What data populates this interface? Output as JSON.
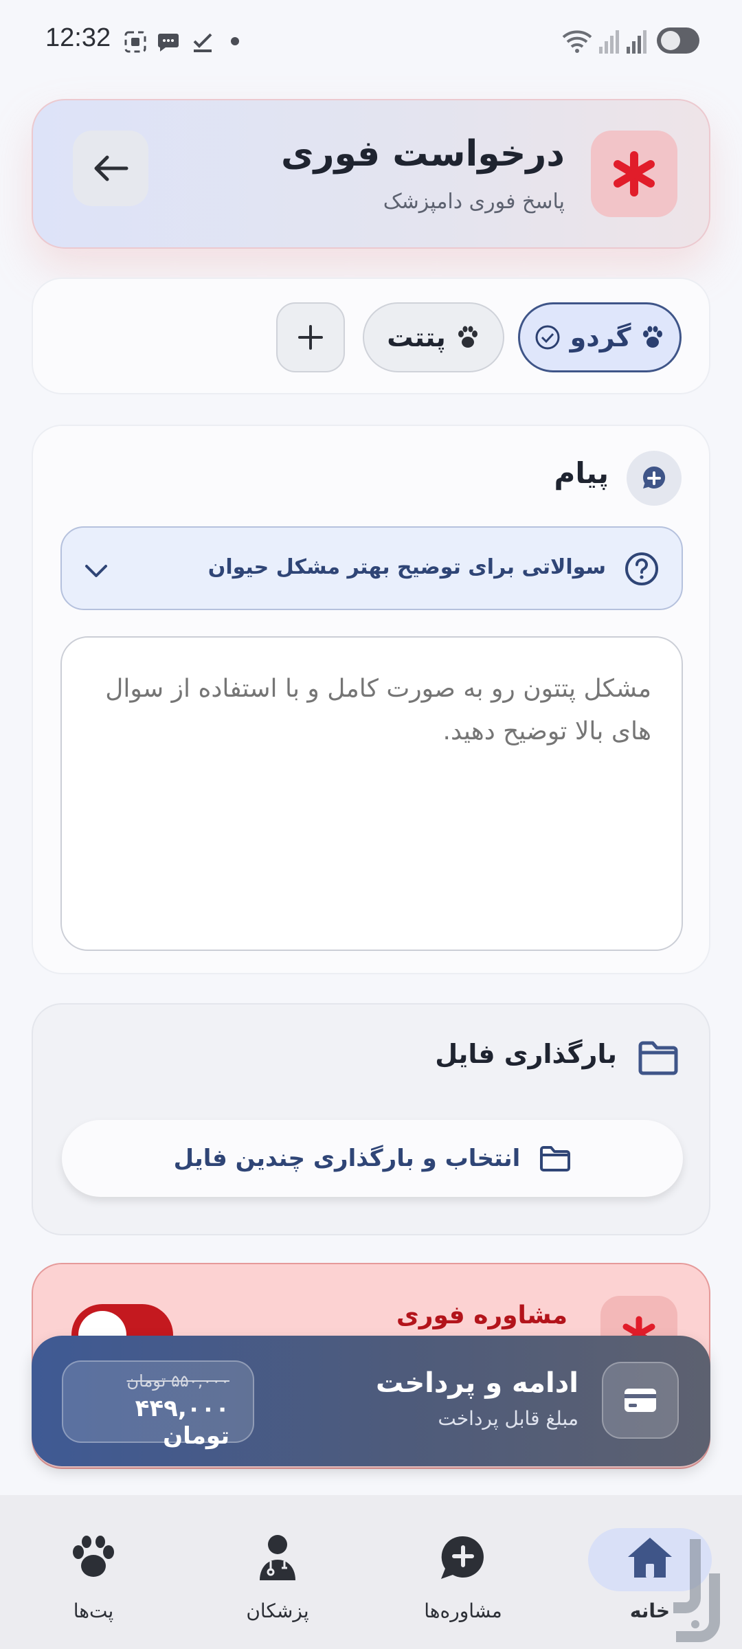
{
  "status_bar": {
    "time": "12:32"
  },
  "header": {
    "title": "درخواست فوری",
    "subtitle": "پاسخ فوری دامپزشک",
    "badge_color": "#e11d2a"
  },
  "pets": {
    "items": [
      {
        "name": "گردو",
        "selected": true
      },
      {
        "name": "پتتت",
        "selected": false
      }
    ],
    "add_icon": "plus-icon"
  },
  "message": {
    "title": "پیام",
    "faq_label": "سوالاتی برای توضیح بهتر مشکل حیوان",
    "placeholder": "مشکل پتتون رو به صورت کامل و با استفاده از سوال های بالا توضیح دهید."
  },
  "upload": {
    "title": "بارگذاری فایل",
    "button_label": "انتخاب و بارگذاری چندین فایل"
  },
  "urgent": {
    "title": "مشاوره فوری",
    "enabled": true
  },
  "payment": {
    "title": "ادامه و پرداخت",
    "subtitle": "مبلغ قابل پرداخت",
    "old_price": "۵۵۰,۰۰۰ تومان",
    "new_price": "۴۴۹,۰۰۰ تومان"
  },
  "nav": {
    "home": "خانه",
    "consultations": "مشاوره‌ها",
    "doctors": "پزشکان",
    "pets": "پت‌ها",
    "active": "home",
    "accent": "#3f5a94"
  }
}
